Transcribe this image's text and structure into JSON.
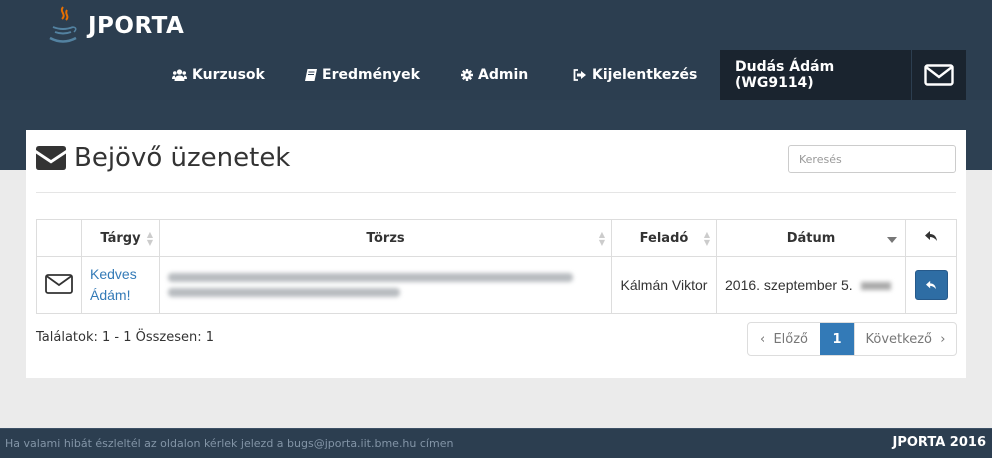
{
  "app": {
    "brand": "JPORTA"
  },
  "nav": {
    "courses": "Kurzusok",
    "results": "Eredmények",
    "admin": "Admin",
    "logout": "Kijelentkezés",
    "user": "Dudás Ádám (WG9114)"
  },
  "page": {
    "title": "Bejövő üzenetek",
    "search_placeholder": "Keresés"
  },
  "table": {
    "headers": {
      "subject": "Tárgy",
      "body": "Törzs",
      "sender": "Feladó",
      "date": "Dátum"
    },
    "rows": [
      {
        "subject": "Kedves Ádám!",
        "sender": "Kálmán Viktor",
        "date": "2016. szeptember 5."
      }
    ]
  },
  "pagination": {
    "summary": "Találatok: 1 - 1 Összesen: 1",
    "prev": "Előző",
    "current": "1",
    "next": "Következő"
  },
  "footer": {
    "left": "Ha valami hibát észleltél az oldalon kérlek jelezd a bugs@jporta.iit.bme.hu címen",
    "right": "JPORTA 2016"
  },
  "colors": {
    "navbar": "#2c3e50",
    "accent": "#337ab7",
    "user_bg": "#1a242f"
  },
  "icons": [
    "java-logo-icon",
    "users-icon",
    "book-icon",
    "gear-icon",
    "sign-out-icon",
    "envelope-icon",
    "reply-icon"
  ]
}
